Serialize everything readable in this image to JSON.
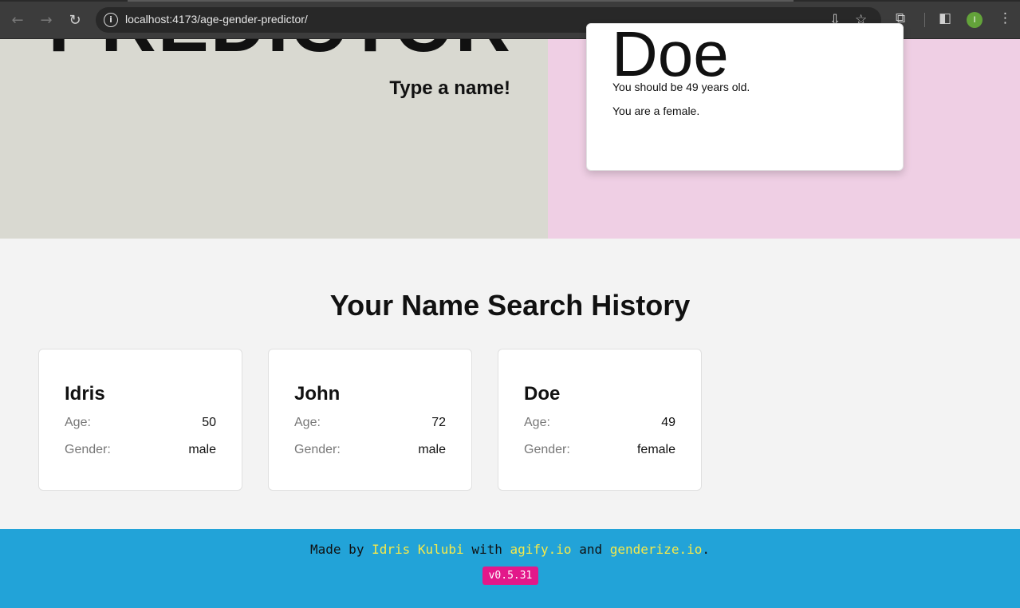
{
  "browser": {
    "url": "localhost:4173/age-gender-predictor/",
    "back_icon": "arrow-left-icon",
    "forward_icon": "arrow-right-icon",
    "reload_icon": "reload-icon",
    "profile_initial": "I"
  },
  "hero": {
    "big_title": "PREDICTOR",
    "subtitle": "Type a name!"
  },
  "result": {
    "name": "Doe",
    "age_text": "You should be 49 years old.",
    "gender_text": "You are a female."
  },
  "history": {
    "title": "Your Name Search History",
    "age_label": "Age:",
    "gender_label": "Gender:",
    "entries": [
      {
        "name": "Idris",
        "age": "50",
        "gender": "male"
      },
      {
        "name": "John",
        "age": "72",
        "gender": "male"
      },
      {
        "name": "Doe",
        "age": "49",
        "gender": "female"
      }
    ]
  },
  "footer": {
    "made_by": "Made by",
    "author": "Idris Kulubi",
    "with": "with",
    "agify": "agify.io",
    "and": "and",
    "genderize": "genderize.io",
    "period": ".",
    "version": "v0.5.31"
  },
  "colors": {
    "hero_left_bg": "#d9d9d1",
    "hero_right_bg": "#efcfe4",
    "footer_bg": "#22a3d8",
    "link": "#f5e94a",
    "badge": "#e3188a"
  }
}
